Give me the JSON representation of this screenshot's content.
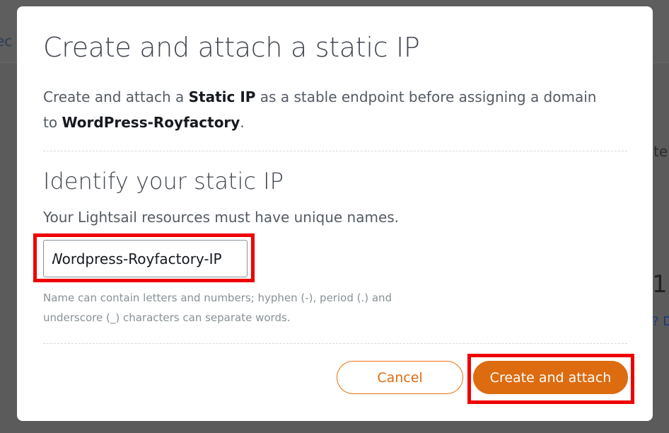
{
  "background": {
    "fragment_left": "ec",
    "fragment_right_1": "te",
    "fragment_right_2": "1",
    "fragment_right_3": "? D"
  },
  "modal": {
    "title": "Create and attach a static IP",
    "intro": {
      "part1": "Create and attach a ",
      "bold1": "Static IP",
      "part2": " as a stable endpoint before assigning a domain to ",
      "bold2": "WordPress-Royfactory",
      "part3": "."
    },
    "section": {
      "title": "Identify your static IP",
      "description": "Your Lightsail resources must have unique names.",
      "input_value": "Wordpress-Royfactory-IP",
      "hint": "Name can contain letters and numbers; hyphen (-), period (.) and underscore (_) characters can separate words."
    },
    "buttons": {
      "cancel": "Cancel",
      "create_and_attach": "Create and attach"
    }
  },
  "colors": {
    "accent": "#dd6b10",
    "highlight": "#ee0000",
    "overlay": "#5b5b5b"
  }
}
